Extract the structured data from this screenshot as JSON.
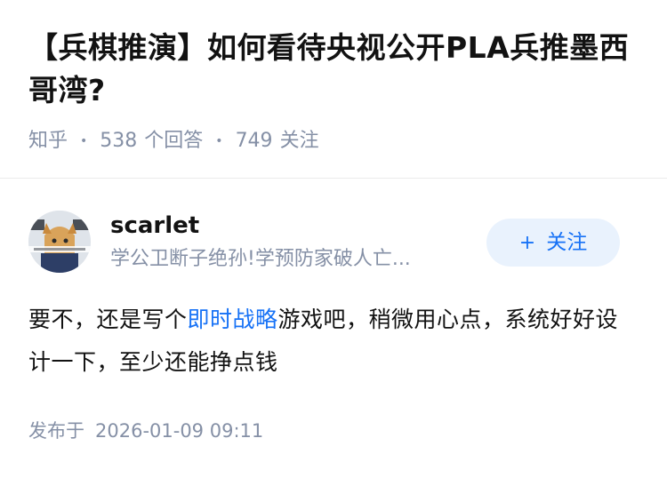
{
  "question": {
    "title": "【兵棋推演】如何看待央视公开PLA兵推墨西哥湾?",
    "source": "知乎",
    "answer_count": "538",
    "answer_label": "个回答",
    "follower_count": "749",
    "follower_label": "关注"
  },
  "answer": {
    "author": {
      "name": "scarlet",
      "bio": "学公卫断子绝孙!学预防家破人亡..."
    },
    "follow_button": {
      "plus": "+",
      "label": "关注"
    },
    "content": {
      "before_link": "要不，还是写个",
      "link_text": "即时战略",
      "after_link": "游戏吧，稍微用心点，系统好好设计一下，至少还能挣点钱"
    },
    "publish": {
      "label": "发布于",
      "datetime": "2026-01-09 09:11"
    }
  },
  "colors": {
    "accent": "#1772f6",
    "follow_bg": "#e9f2fd",
    "muted_text": "#8590a6",
    "primary_text": "#121212",
    "divider": "#ebebeb"
  },
  "icons": {
    "avatar": "avatar-illustration"
  }
}
